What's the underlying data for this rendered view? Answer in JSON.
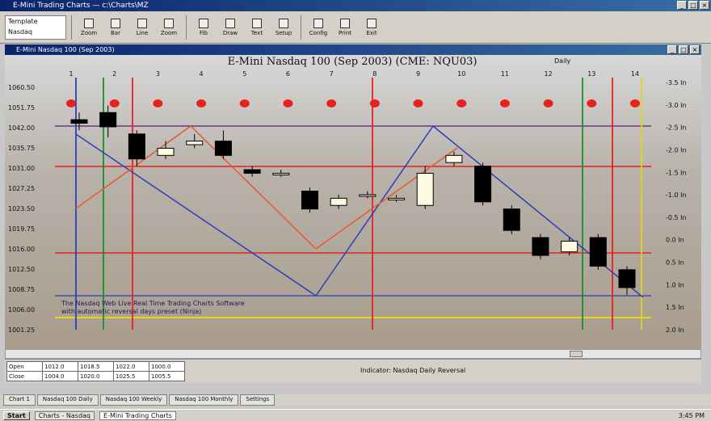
{
  "app": {
    "title": "E-Mini Trading Charts — c:\\Charts\\MZ",
    "child_title": "E-Mini Nasdaq 100 (Sep 2003)"
  },
  "toolbar": {
    "combo_label": "Template",
    "combo_value": "Nasdaq",
    "buttons": [
      "Zoom",
      "Bar",
      "Line",
      "Zoom",
      "Fib",
      "Draw",
      "Text",
      "Setup",
      "Config",
      "Print",
      "Exit"
    ]
  },
  "chart_data": {
    "type": "candlestick",
    "title": "E-Mini Nasdaq 100 (Sep 2003) (CME: NQU03)",
    "subtitle": "Daily",
    "left_ticks": [
      "1060.50",
      "1051.75",
      "1042.00",
      "1035.75",
      "1031.00",
      "1027.25",
      "1023.50",
      "1019.75",
      "1016.00",
      "1012.50",
      "1008.75",
      "1006.00",
      "1001.25"
    ],
    "right_ticks": [
      "-3.5 In",
      "-3.0 In",
      "-2.5 In",
      "-2.0 In",
      "-1.5 In",
      "-1.0 In",
      "-0.5 In",
      "0.0 In",
      "0.5 In",
      "1.0 In",
      "1.5 In",
      "2.0 In"
    ],
    "top_markers": [
      "1",
      "2",
      "3",
      "4",
      "5",
      "6",
      "7",
      "8",
      "9",
      "10",
      "11",
      "12",
      "13",
      "14"
    ],
    "candles": [
      {
        "o": 1047,
        "c": 1046,
        "h": 1049,
        "l": 1044
      },
      {
        "o": 1049,
        "c": 1045,
        "h": 1051,
        "l": 1042
      },
      {
        "o": 1043,
        "c": 1036,
        "h": 1044,
        "l": 1034
      },
      {
        "o": 1037,
        "c": 1039,
        "h": 1041,
        "l": 1036
      },
      {
        "o": 1040,
        "c": 1041,
        "h": 1043,
        "l": 1039
      },
      {
        "o": 1041,
        "c": 1037,
        "h": 1044,
        "l": 1036
      },
      {
        "o": 1033,
        "c": 1032,
        "h": 1034,
        "l": 1031
      },
      {
        "o": 1032,
        "c": 1032,
        "h": 1033,
        "l": 1031
      },
      {
        "o": 1027,
        "c": 1022,
        "h": 1028,
        "l": 1021
      },
      {
        "o": 1023,
        "c": 1025,
        "h": 1026,
        "l": 1022
      },
      {
        "o": 1026,
        "c": 1026,
        "h": 1027,
        "l": 1025
      },
      {
        "o": 1025,
        "c": 1025,
        "h": 1026,
        "l": 1024
      },
      {
        "o": 1023,
        "c": 1032,
        "h": 1034,
        "l": 1022
      },
      {
        "o": 1035,
        "c": 1037,
        "h": 1038,
        "l": 1034
      },
      {
        "o": 1034,
        "c": 1024,
        "h": 1035,
        "l": 1023
      },
      {
        "o": 1022,
        "c": 1016,
        "h": 1023,
        "l": 1015
      },
      {
        "o": 1014,
        "c": 1009,
        "h": 1015,
        "l": 1008
      },
      {
        "o": 1010,
        "c": 1013,
        "h": 1014,
        "l": 1009
      },
      {
        "o": 1014,
        "c": 1006,
        "h": 1015,
        "l": 1005
      },
      {
        "o": 1005,
        "c": 1000,
        "h": 1006,
        "l": 998
      }
    ],
    "annotation_1": "The Nasdaq Web Live Real Time Trading Charts Software",
    "annotation_2": "with automatic reversal days preset (Ninja)",
    "colors": {
      "red": "#e8201e",
      "blue": "#2a3fb8",
      "green": "#1a8f2a",
      "yellow": "#e6d21a",
      "orange": "#e85a2a"
    }
  },
  "ohlc_panel": {
    "rows": [
      [
        "Open",
        "1012.0",
        "1018.5",
        "1022.0",
        "1000.0"
      ],
      [
        "Close",
        "1004.0",
        "1020.0",
        "1025.5",
        "1005.5"
      ]
    ],
    "note": "Indicator: Nasdaq Daily Reversal"
  },
  "status_tabs": [
    "Chart 1",
    "Nasdaq 100 Daily",
    "Nasdaq 100 Weekly",
    "Nasdaq 100 Monthly",
    "Settings"
  ],
  "taskbar": {
    "start": "Start",
    "items": [
      "Charts - Nasdaq",
      "E-Mini Trading Charts"
    ],
    "clock": "3:45 PM"
  }
}
